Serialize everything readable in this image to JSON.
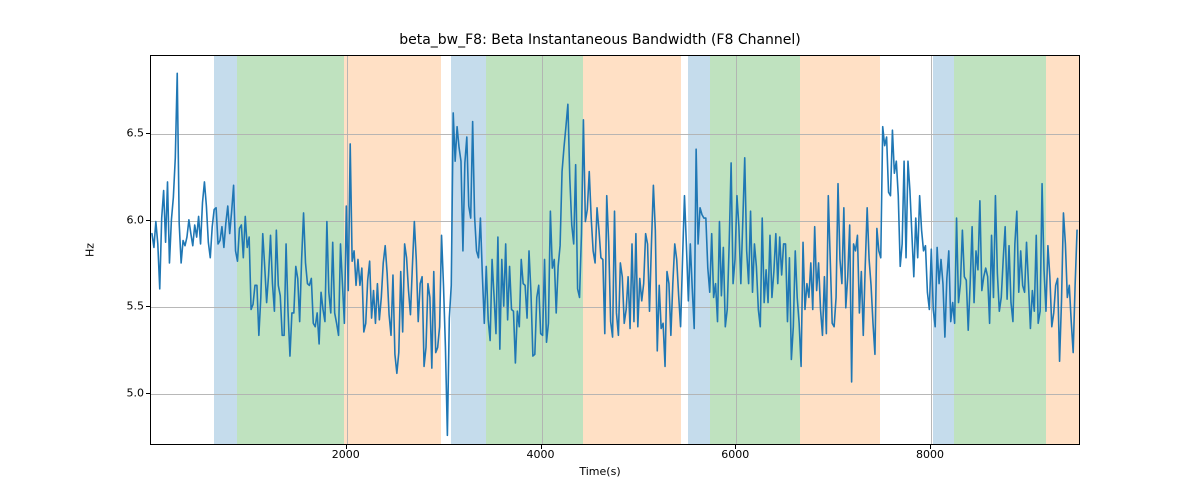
{
  "chart_data": {
    "type": "line",
    "title": "beta_bw_F8: Beta Instantaneous Bandwidth (F8 Channel)",
    "xlabel": "Time(s)",
    "ylabel": "Hz",
    "xlim": [
      -10,
      9540
    ],
    "ylim": [
      4.7,
      6.95
    ],
    "x_ticks": [
      2000,
      4000,
      6000,
      8000
    ],
    "y_ticks": [
      5.0,
      5.5,
      6.0,
      6.5
    ],
    "bands": [
      {
        "x0": 640,
        "x1": 870,
        "color": "#1f77b4"
      },
      {
        "x0": 870,
        "x1": 1970,
        "color": "#2ca02c"
      },
      {
        "x0": 1970,
        "x1": 2970,
        "color": "#ff7f0e"
      },
      {
        "x0": 3070,
        "x1": 3430,
        "color": "#1f77b4"
      },
      {
        "x0": 3430,
        "x1": 4430,
        "color": "#2ca02c"
      },
      {
        "x0": 4430,
        "x1": 5430,
        "color": "#ff7f0e"
      },
      {
        "x0": 5500,
        "x1": 5730,
        "color": "#1f77b4"
      },
      {
        "x0": 5730,
        "x1": 6650,
        "color": "#2ca02c"
      },
      {
        "x0": 6650,
        "x1": 7480,
        "color": "#ff7f0e"
      },
      {
        "x0": 8020,
        "x1": 8240,
        "color": "#1f77b4"
      },
      {
        "x0": 8240,
        "x1": 9180,
        "color": "#2ca02c"
      },
      {
        "x0": 9180,
        "x1": 9530,
        "color": "#ff7f0e"
      }
    ],
    "band_opacities": {
      "#1f77b4": 0.26,
      "#2ca02c": 0.3,
      "#ff7f0e": 0.24
    },
    "series": [
      {
        "name": "beta_bw_F8",
        "x_step": 20,
        "x_start": 0,
        "values": [
          5.92,
          5.84,
          5.99,
          5.86,
          5.6,
          6.01,
          6.17,
          5.87,
          6.22,
          5.75,
          6.0,
          6.13,
          6.36,
          6.85,
          5.98,
          5.75,
          5.88,
          5.85,
          5.9,
          6.0,
          5.92,
          5.85,
          5.97,
          5.9,
          6.02,
          5.86,
          6.1,
          6.22,
          6.08,
          5.87,
          5.78,
          5.96,
          6.06,
          6.07,
          5.86,
          5.88,
          5.96,
          5.84,
          5.98,
          6.08,
          5.92,
          6.05,
          6.2,
          5.82,
          5.76,
          5.95,
          5.97,
          5.78,
          6.02,
          5.84,
          5.9,
          5.48,
          5.51,
          5.62,
          5.62,
          5.33,
          5.55,
          5.92,
          5.73,
          5.52,
          5.68,
          5.91,
          5.63,
          5.47,
          5.94,
          5.62,
          5.56,
          5.33,
          5.33,
          5.86,
          5.47,
          5.21,
          5.46,
          5.46,
          5.73,
          5.66,
          5.41,
          5.77,
          6.04,
          5.75,
          5.63,
          5.62,
          5.66,
          5.4,
          5.38,
          5.46,
          5.28,
          5.58,
          5.48,
          5.41,
          5.99,
          5.58,
          5.46,
          5.87,
          5.46,
          5.4,
          5.33,
          5.86,
          5.63,
          5.4,
          6.08,
          5.59,
          6.44,
          5.76,
          5.82,
          5.62,
          5.77,
          5.62,
          5.72,
          5.35,
          5.4,
          5.65,
          5.76,
          5.43,
          5.59,
          5.4,
          5.63,
          5.42,
          5.55,
          5.75,
          5.85,
          5.69,
          5.45,
          5.33,
          5.68,
          5.22,
          5.11,
          5.23,
          5.7,
          5.35,
          5.86,
          5.78,
          5.59,
          5.45,
          5.73,
          5.99,
          5.77,
          5.41,
          5.63,
          5.67,
          5.15,
          5.26,
          5.63,
          5.55,
          5.14,
          5.7,
          5.23,
          5.26,
          5.38,
          5.91,
          5.62,
          5.26,
          4.75,
          5.43,
          5.62,
          6.62,
          6.34,
          6.54,
          6.42,
          6.34,
          5.82,
          6.33,
          6.48,
          6.08,
          6.01,
          6.57,
          6.02,
          5.82,
          5.78,
          6.01,
          5.68,
          5.4,
          5.73,
          5.42,
          5.3,
          5.77,
          5.56,
          5.34,
          5.9,
          5.25,
          5.77,
          5.5,
          5.86,
          5.42,
          5.73,
          5.48,
          5.47,
          5.17,
          5.47,
          5.38,
          5.77,
          5.63,
          5.62,
          5.43,
          5.82,
          5.58,
          5.21,
          5.22,
          5.55,
          5.62,
          5.34,
          5.33,
          5.77,
          5.29,
          5.4,
          6.05,
          5.72,
          5.77,
          5.46,
          5.73,
          5.85,
          6.28,
          6.42,
          6.54,
          6.67,
          6.24,
          5.97,
          5.86,
          6.32,
          5.6,
          5.55,
          5.92,
          6.58,
          5.99,
          6.06,
          6.28,
          6.01,
          5.82,
          5.75,
          6.07,
          5.94,
          5.78,
          5.77,
          5.34,
          6.14,
          5.87,
          5.41,
          5.32,
          6.05,
          5.46,
          5.33,
          5.75,
          5.67,
          5.4,
          5.48,
          5.67,
          5.37,
          5.86,
          5.41,
          5.92,
          5.38,
          5.66,
          5.53,
          5.63,
          5.92,
          5.86,
          5.47,
          5.86,
          6.2,
          5.94,
          5.24,
          5.62,
          5.37,
          5.4,
          5.15,
          5.7,
          5.63,
          5.33,
          5.63,
          5.86,
          5.77,
          5.56,
          5.38,
          5.77,
          6.14,
          5.85,
          5.53,
          5.86,
          5.6,
          5.37,
          6.41,
          5.86,
          6.07,
          6.03,
          6.01,
          6.01,
          5.72,
          5.58,
          5.92,
          5.55,
          5.63,
          5.41,
          5.99,
          5.56,
          5.84,
          5.38,
          5.48,
          5.86,
          6.33,
          5.63,
          5.77,
          6.14,
          5.96,
          5.63,
          5.99,
          6.36,
          5.82,
          5.63,
          6.05,
          5.58,
          5.86,
          5.73,
          5.48,
          5.38,
          6.01,
          5.52,
          5.71,
          5.52,
          5.91,
          5.55,
          5.7,
          5.92,
          5.63,
          5.9,
          5.68,
          5.86,
          5.86,
          5.41,
          5.78,
          5.19,
          5.38,
          5.82,
          5.55,
          5.4,
          5.15,
          5.87,
          5.48,
          5.63,
          5.55,
          5.75,
          5.48,
          5.96,
          5.59,
          5.75,
          5.48,
          5.33,
          5.67,
          5.34,
          6.14,
          5.77,
          5.4,
          5.38,
          5.55,
          6.21,
          5.77,
          5.63,
          6.07,
          5.49,
          5.67,
          5.97,
          5.06,
          5.86,
          5.82,
          5.91,
          5.46,
          5.7,
          5.33,
          5.73,
          6.07,
          5.77,
          5.62,
          5.4,
          5.22,
          5.95,
          5.82,
          5.78,
          6.54,
          6.43,
          6.48,
          6.16,
          6.14,
          6.52,
          6.27,
          6.34,
          6.14,
          5.73,
          5.86,
          6.34,
          5.78,
          6.34,
          6.17,
          5.92,
          5.67,
          6.01,
          5.78,
          6.14,
          5.94,
          5.82,
          5.85,
          5.58,
          5.48,
          5.83,
          5.48,
          5.38,
          5.84,
          5.63,
          5.77,
          5.63,
          5.32,
          5.66,
          5.82,
          5.41,
          5.52,
          5.4,
          6.01,
          5.52,
          5.63,
          5.94,
          5.67,
          5.65,
          5.36,
          5.63,
          5.96,
          5.52,
          5.82,
          5.71,
          6.11,
          5.59,
          5.67,
          5.72,
          5.67,
          5.4,
          5.91,
          5.55,
          6.14,
          5.69,
          5.47,
          5.55,
          5.77,
          5.96,
          5.54,
          5.85,
          5.52,
          5.41,
          5.86,
          6.05,
          5.58,
          5.82,
          5.62,
          5.58,
          5.87,
          5.63,
          5.37,
          5.59,
          5.47,
          5.91,
          5.4,
          5.47,
          6.21,
          5.71,
          5.47,
          5.85,
          5.67,
          5.38,
          5.46,
          5.62,
          5.66,
          5.18,
          5.53,
          6.04,
          5.86,
          5.55,
          5.62,
          5.41,
          5.23,
          5.62,
          5.94
        ]
      }
    ]
  }
}
